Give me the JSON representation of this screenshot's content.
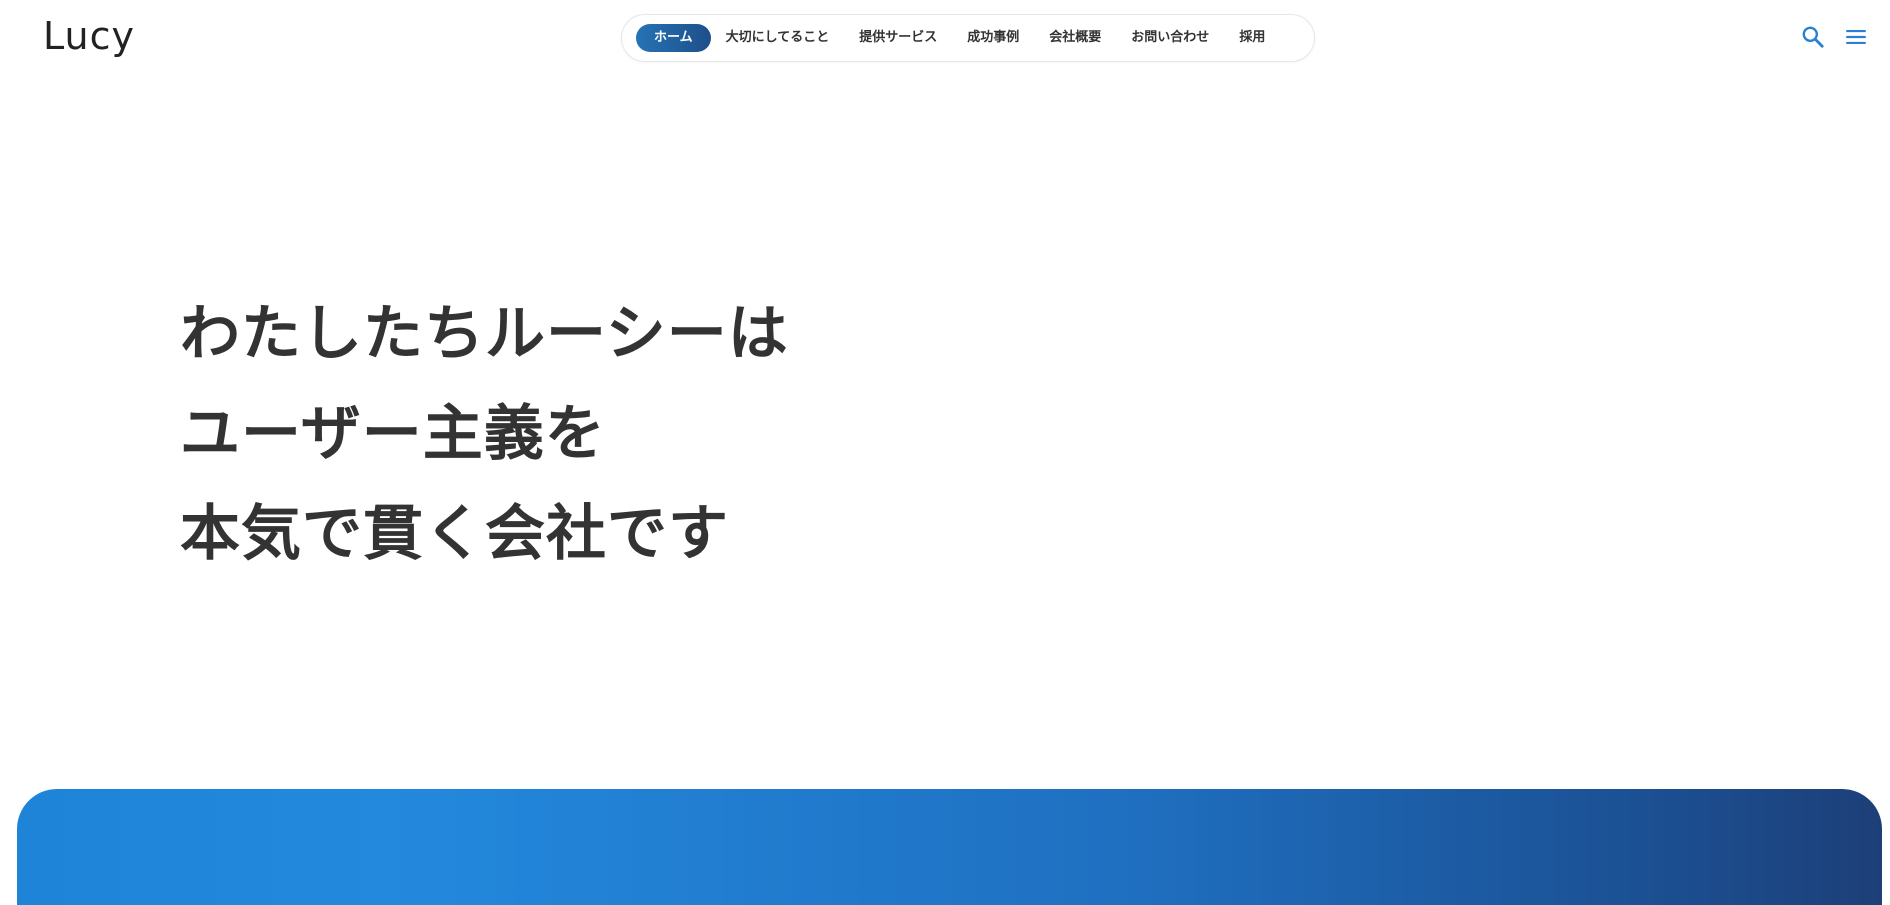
{
  "header": {
    "logo": "Lucy",
    "nav": [
      {
        "label": "ホーム",
        "active": true
      },
      {
        "label": "大切にしてること",
        "active": false
      },
      {
        "label": "提供サービス",
        "active": false
      },
      {
        "label": "成功事例",
        "active": false
      },
      {
        "label": "会社概要",
        "active": false
      },
      {
        "label": "お問い合わせ",
        "active": false
      },
      {
        "label": "採用",
        "active": false
      }
    ],
    "icons": {
      "search": "search-icon",
      "menu": "hamburger-menu-icon"
    }
  },
  "hero": {
    "lines": [
      "わたしたちルーシーは",
      "ユーザー主義を",
      "本気で貫く会社です"
    ]
  },
  "colors": {
    "accent": "#2573b6",
    "accent_dark": "#1e4f8a",
    "icon": "#2a7fd4",
    "text": "#333333",
    "band_start": "#1e84d8",
    "band_end": "#1d3f78"
  }
}
